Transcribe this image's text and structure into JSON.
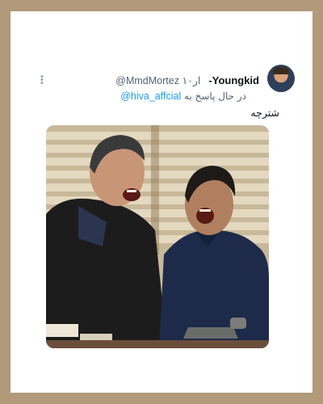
{
  "tweet": {
    "display_name": "Youngkid-",
    "handle": "@MmdMortez",
    "time": "۱۰ار",
    "reply_prefix": "در حال پاسخ به",
    "reply_mention": "@hiva_affcial",
    "text": "شترچه"
  },
  "icons": {
    "avatar": "user-avatar",
    "more": "more-options-icon",
    "media": "tv-show-still-photo"
  },
  "colors": {
    "frame": "#b09a7a",
    "card": "#ffffff",
    "link": "#1d9bf0",
    "secondary_text": "#536471"
  }
}
